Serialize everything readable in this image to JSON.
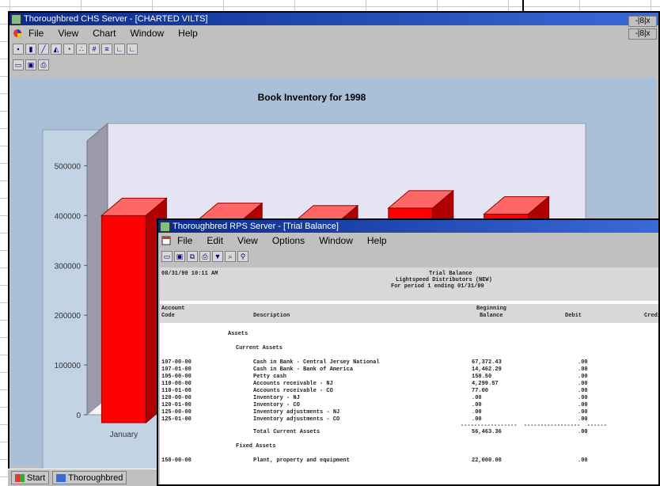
{
  "chart_window": {
    "title": "Thoroughbred CHS Server - [CHARTED VILTS]",
    "menu": [
      "File",
      "View",
      "Chart",
      "Window",
      "Help"
    ],
    "mdi_controls": [
      "-|8|x",
      "-|8|x"
    ]
  },
  "chart_data": {
    "type": "bar",
    "title": "Book Inventory for 1998",
    "categories": [
      "January",
      "",
      "",
      "",
      ""
    ],
    "values": [
      400000,
      390000,
      385000,
      415000,
      403000
    ],
    "yticks": [
      "0",
      "100000",
      "200000",
      "300000",
      "400000",
      "500000"
    ],
    "ylim": [
      0,
      550000
    ],
    "bar_color": "#ff0000",
    "back_wall_color": "#e4e4f2",
    "client_color": "#aac0d8"
  },
  "taskbar": {
    "start_label": "Start",
    "task_label": "Thoroughbred"
  },
  "report_window": {
    "title": "Thoroughbred RPS Server - [Trial Balance]",
    "menu": [
      "File",
      "Edit",
      "View",
      "Options",
      "Window",
      "Help"
    ]
  },
  "report": {
    "date": "08/31/99 10:11 AM",
    "heading1": "Trial Balance",
    "heading2": "Lightspeed Distributors (NEW)",
    "heading3": "For period 1 ending 01/31/99",
    "col_account_1": "Account",
    "col_account_2": "Code",
    "col_desc": "Description",
    "col_begin_1": "Beginning",
    "col_begin_2": "Balance",
    "col_debit": "Debit",
    "col_credit": "Credi",
    "section_assets": "Assets",
    "section_current": "Current Assets",
    "rows": [
      {
        "code": "107-00-00",
        "desc": "Cash in Bank - Central Jersey National",
        "bal": "67,372.43",
        "dr": ".00"
      },
      {
        "code": "107-01-00",
        "desc": "Cash in Bank - Bank of America",
        "bal": "14,462.29",
        "dr": ".00"
      },
      {
        "code": "105-00-00",
        "desc": "Petty cash",
        "bal": "150.50",
        "dr": ".00"
      },
      {
        "code": "110-00-00",
        "desc": "Accounts receivable - NJ",
        "bal": "4,299.57",
        "dr": ".00"
      },
      {
        "code": "110-01-00",
        "desc": "Accounts receivable - CO",
        "bal": "77.00",
        "dr": ".00"
      },
      {
        "code": "120-00-00",
        "desc": "Inventory - NJ",
        "bal": ".00",
        "dr": ".00"
      },
      {
        "code": "120-01-00",
        "desc": "Inventory - CO",
        "bal": ".00",
        "dr": ".00"
      },
      {
        "code": "125-00-00",
        "desc": "Inventory adjustments - NJ",
        "bal": ".00",
        "dr": ".00"
      },
      {
        "code": "125-01-00",
        "desc": "Inventory adjustments - CO",
        "bal": ".00",
        "dr": ".00"
      }
    ],
    "total_label": "Total Current Assets",
    "total_bal": "56,463.36",
    "total_dr": ".00",
    "section_fixed": "Fixed Assets",
    "fixed_code": "150-00-00",
    "fixed_desc": "Plant, property and equipment",
    "fixed_bal": "22,000.00",
    "fixed_dr": ".00"
  }
}
